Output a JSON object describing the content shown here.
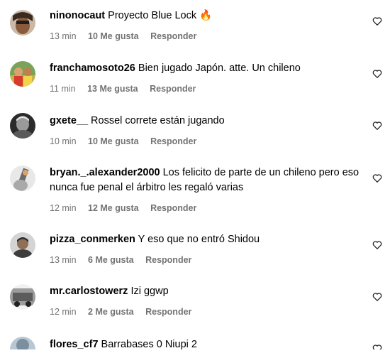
{
  "comments": [
    {
      "username": "ninonocaut",
      "text": "Proyecto Blue Lock 🔥",
      "time": "13 min",
      "likes": "10 Me gusta",
      "reply": "Responder"
    },
    {
      "username": "franchamosoto26",
      "text": "Bien jugado Japón. atte. Un chileno",
      "time": "11 min",
      "likes": "13 Me gusta",
      "reply": "Responder"
    },
    {
      "username": "gxete__",
      "text": "Rossel correte están jugando",
      "time": "10 min",
      "likes": "10 Me gusta",
      "reply": "Responder"
    },
    {
      "username": "bryan._.alexander2000",
      "text": "Los felicito de parte de un chileno pero eso nunca fue penal el árbitro les regaló varias",
      "time": "12 min",
      "likes": "12 Me gusta",
      "reply": "Responder"
    },
    {
      "username": "pizza_conmerken",
      "text": "Y eso que no entró Shidou",
      "time": "13 min",
      "likes": "6 Me gusta",
      "reply": "Responder"
    },
    {
      "username": "mr.carlostowerz",
      "text": "Izi ggwp",
      "time": "12 min",
      "likes": "2 Me gusta",
      "reply": "Responder"
    },
    {
      "username": "flores_cf7",
      "text": "Barrabases 0 Niupi 2",
      "time": "",
      "likes": "",
      "reply": ""
    }
  ],
  "icons": {
    "heart": "heart-outline-icon"
  },
  "colors": {
    "meta": "#737373",
    "text": "#000000"
  }
}
